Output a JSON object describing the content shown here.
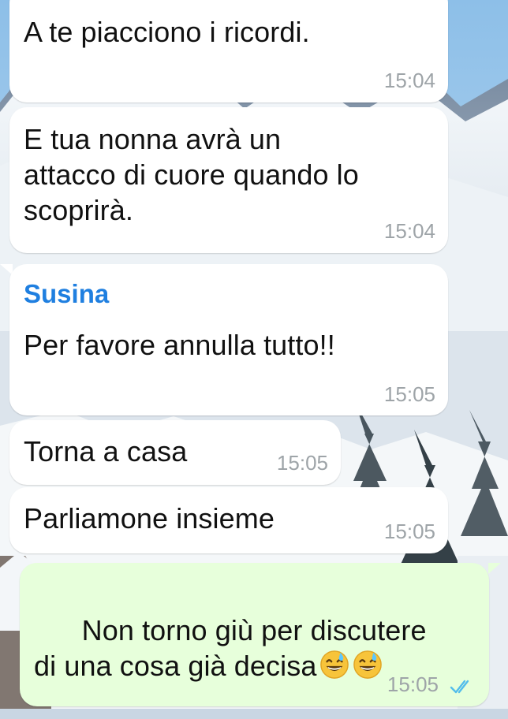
{
  "messages": [
    {
      "text": "A te piacciono i ricordi.",
      "time": "15:04"
    },
    {
      "text": "E tua nonna avrà un\nattacco di cuore quando lo\nscoprirà.",
      "time": "15:04"
    },
    {
      "sender": "Susina",
      "text": "Per favore annulla tutto!!",
      "time": "15:05"
    },
    {
      "text": "Torna a casa",
      "time": "15:05"
    },
    {
      "text": "Parliamone insieme",
      "time": "15:05"
    },
    {
      "text": "Non torno giù per discutere\ndi una cosa già decisa",
      "time": "15:05",
      "status": "read-double-check-icon"
    }
  ],
  "colors": {
    "incoming_bubble": "#ffffff",
    "outgoing_bubble": "#e7ffdb",
    "sender_name": "#1f7fe0",
    "timestamp": "#9ea4a8",
    "read_tick": "#53bdeb"
  },
  "icons": {
    "emoji": "grinning-face-with-sweat-emoji",
    "read_status": "double-check-icon"
  }
}
